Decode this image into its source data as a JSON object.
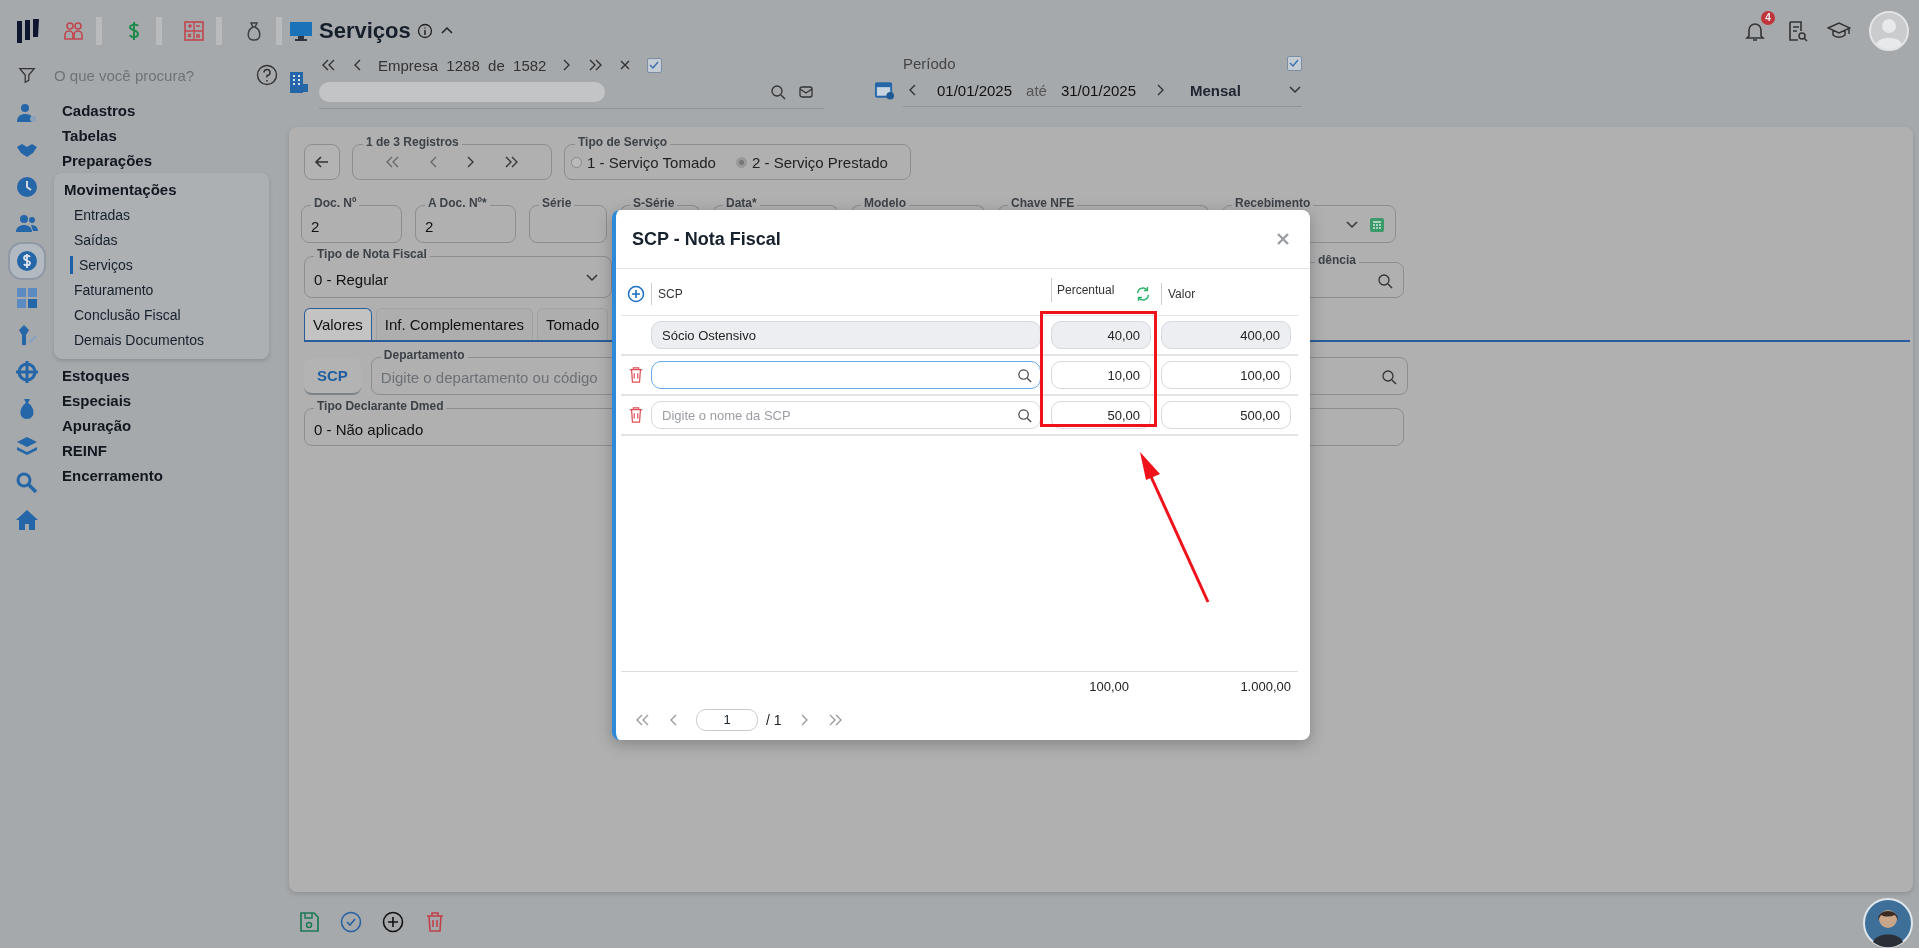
{
  "header": {
    "title": "Serviços"
  },
  "search": {
    "placeholder": "O que você procura?"
  },
  "nav": {
    "items": [
      {
        "label": "Cadastros",
        "expanded": false
      },
      {
        "label": "Tabelas",
        "expanded": false
      },
      {
        "label": "Preparações",
        "expanded": false
      },
      {
        "label": "Movimentações",
        "expanded": true,
        "children": [
          {
            "label": "Entradas",
            "selected": false
          },
          {
            "label": "Saídas",
            "selected": false
          },
          {
            "label": "Serviços",
            "selected": true
          },
          {
            "label": "Faturamento",
            "selected": false
          },
          {
            "label": "Conclusão Fiscal",
            "selected": false
          },
          {
            "label": "Demais Documentos",
            "selected": false
          }
        ]
      },
      {
        "label": "Estoques",
        "expanded": false
      },
      {
        "label": "Especiais",
        "expanded": false
      },
      {
        "label": "Apuração",
        "expanded": false
      },
      {
        "label": "REINF",
        "expanded": false
      },
      {
        "label": "Encerramento",
        "expanded": false
      }
    ]
  },
  "company_nav": {
    "label": "Empresa",
    "current": "1288",
    "of": "de",
    "total": "1582",
    "checked": true
  },
  "period": {
    "label": "Período",
    "from": "01/01/2025",
    "to_label": "até",
    "to": "31/01/2025",
    "frequency": "Mensal",
    "checked": true
  },
  "notifications": {
    "count": "4"
  },
  "records": {
    "label": "1 de 3 Registros"
  },
  "service_type": {
    "label": "Tipo de Serviço",
    "options": [
      {
        "label": "1 - Serviço Tomado",
        "selected": false
      },
      {
        "label": "2 - Serviço Prestado",
        "selected": true
      }
    ]
  },
  "fields": [
    {
      "label": "Doc. Nº",
      "value": "2"
    },
    {
      "label": "A Doc. Nº*",
      "value": "2"
    },
    {
      "label": "Série"
    },
    {
      "label": "S-Série"
    },
    {
      "label": "Data*"
    },
    {
      "label": "Modelo"
    },
    {
      "label": "Chave NFE"
    },
    {
      "label": "Recebimento"
    }
  ],
  "invoice_type": {
    "label": "Tipo de Nota Fiscal",
    "value": "0 - Regular"
  },
  "partial_field": {
    "label": "dência"
  },
  "tabs": [
    {
      "label": "Valores",
      "selected": true
    },
    {
      "label": "Inf. Complementares",
      "selected": false
    },
    {
      "label": "Tomado",
      "selected": false
    }
  ],
  "scp_button": "SCP",
  "department": {
    "label": "Departamento",
    "placeholder": "Digite o departamento ou código"
  },
  "dmed": {
    "label": "Tipo Declarante Dmed",
    "value": "0 - Não aplicado"
  },
  "modal": {
    "title": "SCP - Nota Fiscal",
    "columns": [
      "SCP",
      "Percentual",
      "Valor"
    ],
    "rows": [
      {
        "kind": "fixed",
        "name": "Sócio Ostensivo",
        "percent": "40,00",
        "value": "400,00"
      },
      {
        "kind": "editable",
        "focused": true,
        "percent": "10,00",
        "value": "100,00"
      },
      {
        "kind": "editable",
        "focused": false,
        "placeholder": "Digite o nome da SCP",
        "percent": "50,00",
        "value": "500,00"
      }
    ],
    "totals": {
      "percent": "100,00",
      "value": "1.000,00"
    },
    "pagination": {
      "page": "1",
      "total": "/ 1"
    }
  }
}
